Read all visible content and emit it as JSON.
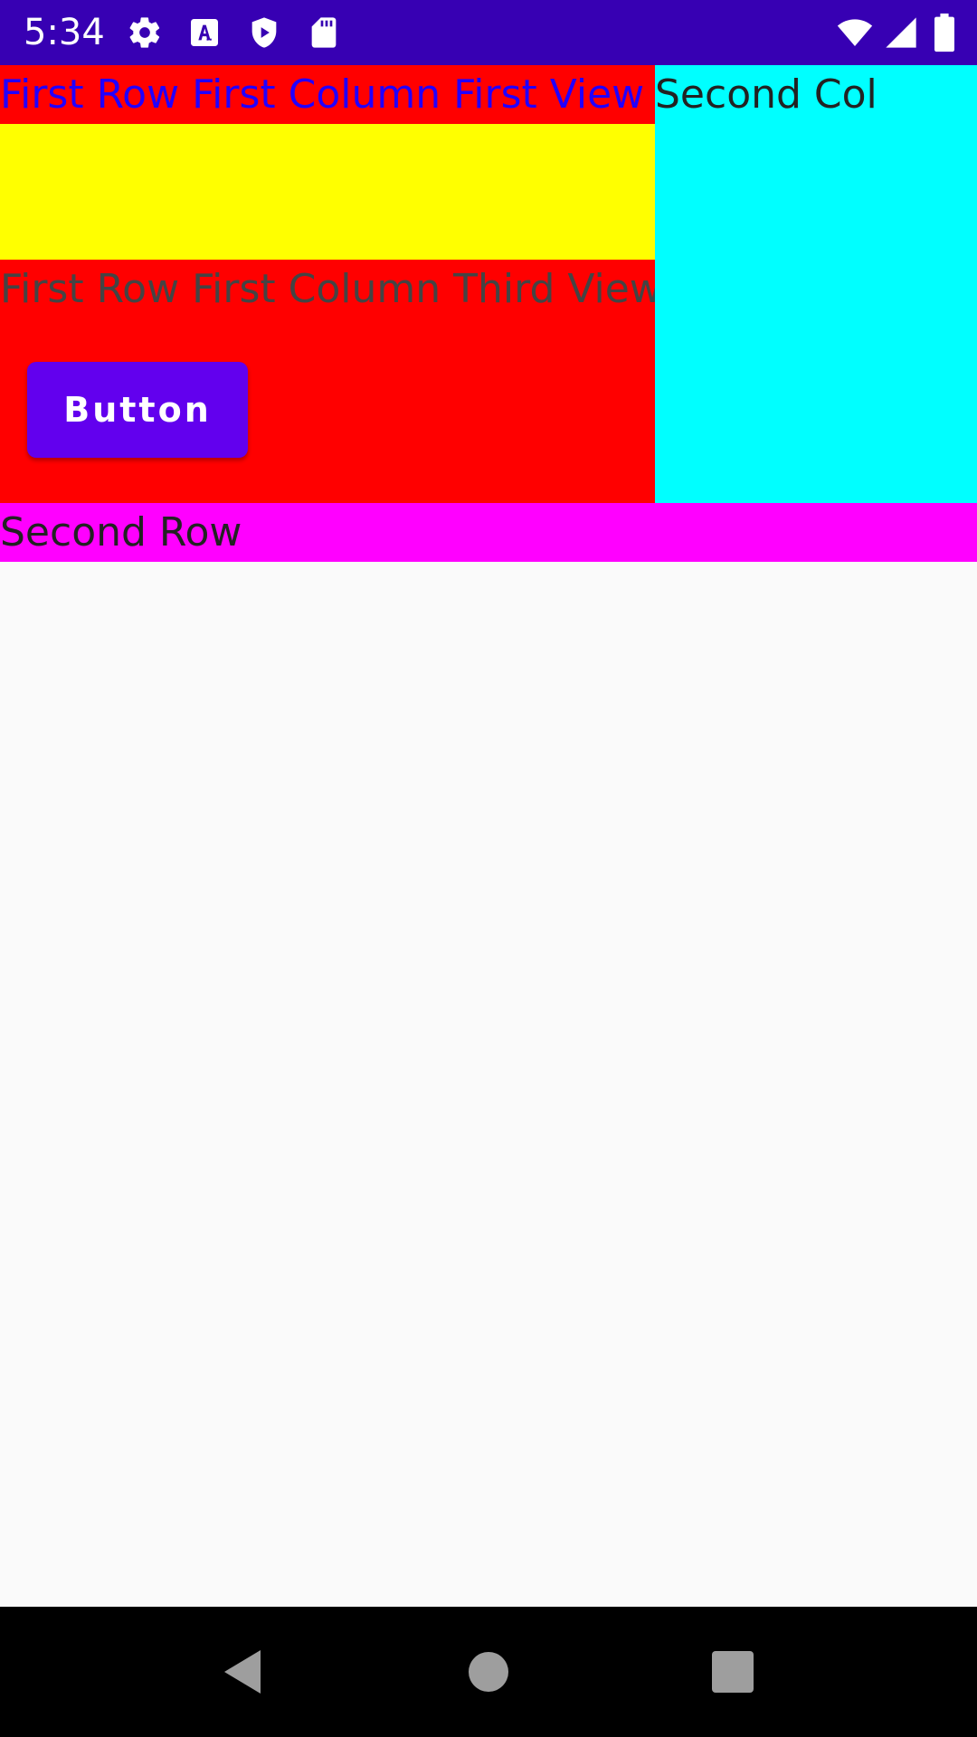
{
  "status_bar": {
    "time": "5:34",
    "left_icons": [
      "gear-icon",
      "font-a-icon",
      "shield-play-icon",
      "sd-card-icon"
    ],
    "right_icons": [
      "wifi-icon",
      "cell-signal-icon",
      "battery-icon"
    ],
    "background": "#3700B3"
  },
  "first_row": {
    "first_column": {
      "first_view": "First Row First Column First View",
      "third_view": "First Row First Column Third View",
      "button_label": "Button",
      "colors": {
        "first_view_bg": "#FF0000",
        "second_view_bg": "#FFFF00",
        "button_bg": "#6200EE"
      }
    },
    "second_column": {
      "label": "Second Col",
      "background": "#00FFFF"
    }
  },
  "second_row": {
    "label": "Second Row",
    "background": "#FF00FF"
  },
  "nav_bar": {
    "buttons": [
      "back-icon",
      "home-icon",
      "recents-icon"
    ]
  }
}
